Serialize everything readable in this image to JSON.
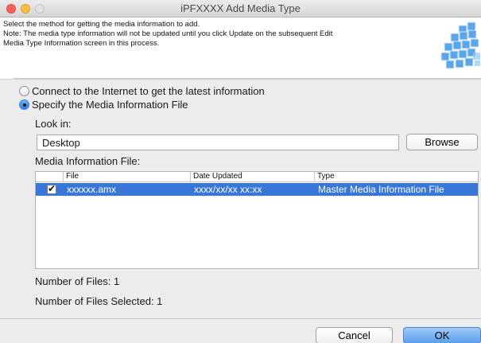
{
  "window": {
    "title": "iPFXXXX Add Media Type"
  },
  "header": {
    "line1": "Select the method for getting the media information to add.",
    "line2": "Note: The media type information will not be updated until you click Update on the subsequent Edit",
    "line3": "Media Type Information screen in this process."
  },
  "options": {
    "internet_label": "Connect to the Internet to get the latest information",
    "internet_selected": false,
    "file_label": "Specify the Media Information File",
    "file_selected": true
  },
  "lookin": {
    "label": "Look in:",
    "value": "Desktop",
    "browse_label": "Browse"
  },
  "media_file": {
    "label": "Media Information File:",
    "columns": [
      "File",
      "Date Updated",
      "Type"
    ],
    "rows": [
      {
        "checked": true,
        "file": "xxxxxx.amx",
        "date": "xxxx/xx/xx xx:xx",
        "type": "Master Media Information File"
      }
    ]
  },
  "counts": {
    "files": "Number of Files: 1",
    "selected": "Number of Files Selected: 1"
  },
  "footer": {
    "cancel_label": "Cancel",
    "ok_label": "OK"
  },
  "colors": {
    "selection": "#3876d8",
    "accent": "#5aa0ec"
  }
}
